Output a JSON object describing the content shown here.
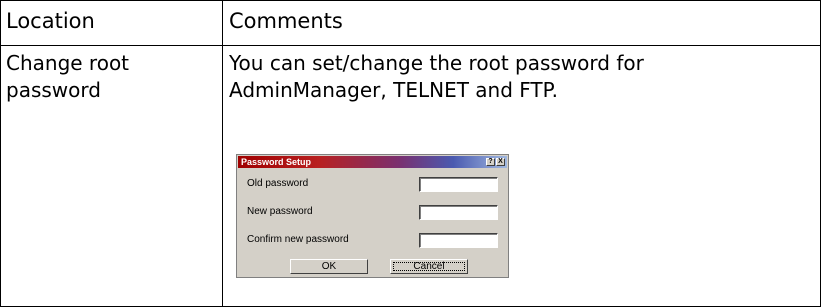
{
  "table": {
    "headers": {
      "location": "Location",
      "comments": "Comments"
    },
    "row": {
      "location_lines": [
        "Change root",
        "password"
      ],
      "comment_lines": [
        "You can set/change the root password for",
        "AdminManager, TELNET and FTP."
      ]
    }
  },
  "dialog": {
    "title": "Password Setup",
    "help_icon": "?",
    "close_icon": "X",
    "fields": [
      {
        "label": "Old password",
        "value": ""
      },
      {
        "label": "New password",
        "value": ""
      },
      {
        "label": "Confirm new password",
        "value": ""
      }
    ],
    "ok_label": "OK",
    "cancel_label": "Cancel",
    "colors": {
      "face": "#d4d0c8",
      "title_start": "#a00000",
      "title_end": "#a0b8e0"
    }
  }
}
